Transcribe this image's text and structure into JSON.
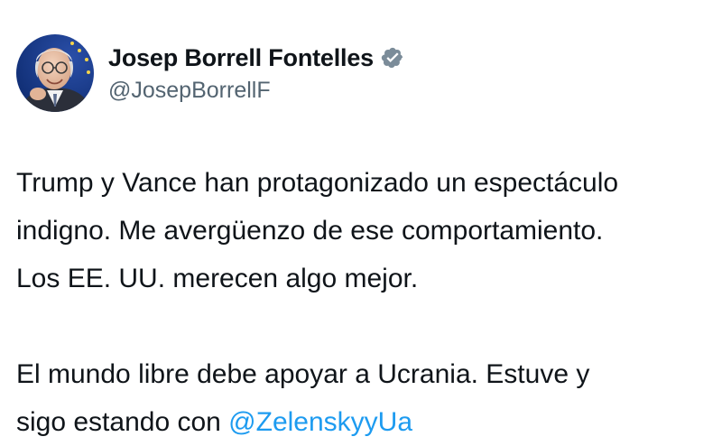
{
  "author": {
    "display_name": "Josep Borrell Fontelles",
    "handle": "@JosepBorrellF",
    "verified": true,
    "avatar_icon": "profile-photo",
    "badge_icon": "verified-badge-icon",
    "badge_color": "#7b8c99"
  },
  "tweet": {
    "paragraph1": {
      "line1": "Trump y Vance han protagonizado un espectáculo",
      "line2": "indigno. Me avergüenzo de ese comportamiento.",
      "line3": "Los EE. UU. merecen algo mejor."
    },
    "paragraph2": {
      "line1": "El mundo libre debe apoyar a Ucrania. Estuve y",
      "line2_prefix": "sigo estando con ",
      "mention": "@ZelenskyyUa"
    }
  },
  "colors": {
    "text": "#0f1419",
    "secondary": "#536471",
    "link": "#1d9bf0"
  }
}
